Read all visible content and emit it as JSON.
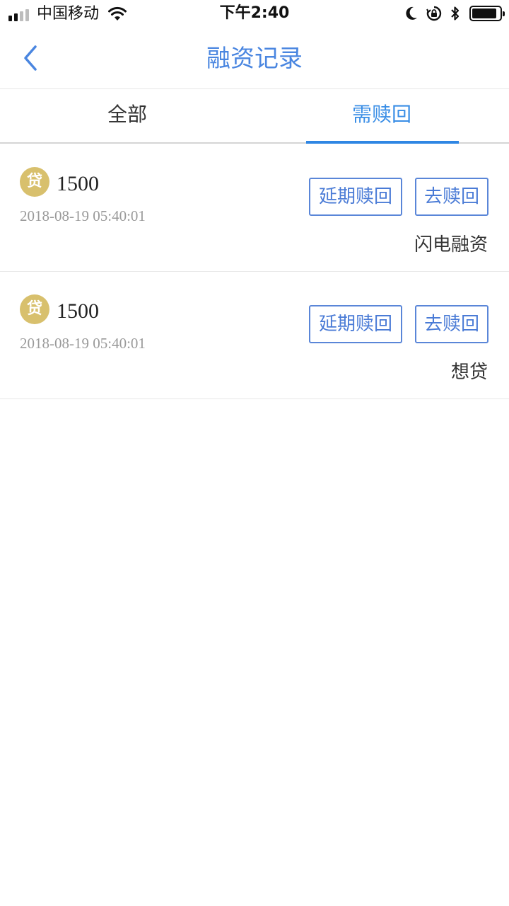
{
  "status_bar": {
    "carrier": "中国移动",
    "time": "下午2:40"
  },
  "nav": {
    "title": "融资记录"
  },
  "tabs": [
    {
      "label": "全部",
      "active": false
    },
    {
      "label": "需赎回",
      "active": true
    }
  ],
  "records": [
    {
      "icon_text": "贷",
      "amount": "1500",
      "datetime": "2018-08-19 05:40:01",
      "extend_label": "延期赎回",
      "redeem_label": "去赎回",
      "platform": "闪电融资"
    },
    {
      "icon_text": "贷",
      "amount": "1500",
      "datetime": "2018-08-19 05:40:01",
      "extend_label": "延期赎回",
      "redeem_label": "去赎回",
      "platform": "想贷"
    }
  ],
  "colors": {
    "accent": "#4a86e0",
    "tab_active": "#2f86e3",
    "loan_icon": "#d8c06d",
    "button_border": "#5a86d8"
  }
}
